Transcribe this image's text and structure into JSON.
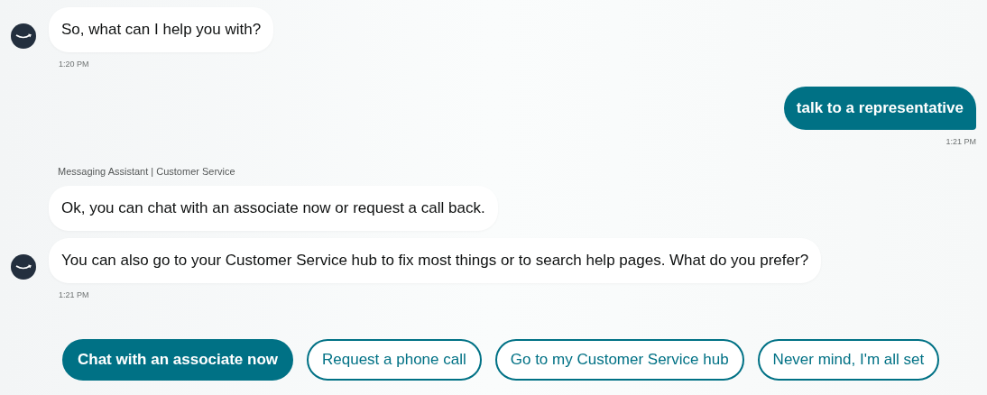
{
  "messages": [
    {
      "kind": "bot",
      "bubbles": [
        "So, what can I help you with?"
      ],
      "time": "1:20 PM"
    },
    {
      "kind": "user",
      "bubbles": [
        "talk to a representative"
      ],
      "time": "1:21 PM"
    },
    {
      "kind": "bot",
      "sender": "Messaging Assistant | Customer Service",
      "bubbles": [
        "Ok, you can chat with an associate now or request a call back.",
        "You can also go to your Customer Service hub to fix most things or to search help pages. What do you prefer?"
      ],
      "time": "1:21 PM"
    }
  ],
  "quick_replies": [
    {
      "label": "Chat with an associate now",
      "selected": true
    },
    {
      "label": "Request a phone call",
      "selected": false
    },
    {
      "label": "Go to my Customer Service hub",
      "selected": false
    },
    {
      "label": "Never mind, I'm all set",
      "selected": false
    }
  ]
}
